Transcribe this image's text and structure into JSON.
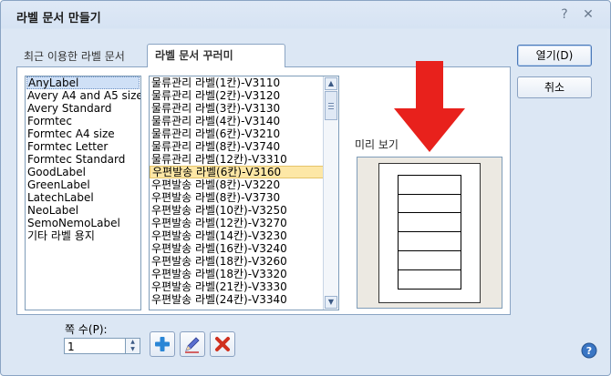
{
  "window": {
    "title": "라벨 문서 만들기",
    "help_glyph": "?",
    "close_glyph": "✕"
  },
  "tabs": [
    {
      "label": "최근 이용한 라벨 문서",
      "active": false
    },
    {
      "label": "라벨 문서 꾸러미",
      "active": true
    }
  ],
  "brands": [
    {
      "label": "AnyLabel",
      "selected": true
    },
    {
      "label": "Avery A4 and A5 size",
      "selected": false
    },
    {
      "label": "Avery Standard",
      "selected": false
    },
    {
      "label": "Formtec",
      "selected": false
    },
    {
      "label": "Formtec A4 size",
      "selected": false
    },
    {
      "label": "Formtec Letter",
      "selected": false
    },
    {
      "label": "Formtec Standard",
      "selected": false
    },
    {
      "label": "GoodLabel",
      "selected": false
    },
    {
      "label": "GreenLabel",
      "selected": false
    },
    {
      "label": "LatechLabel",
      "selected": false
    },
    {
      "label": "NeoLabel",
      "selected": false
    },
    {
      "label": "SemoNemoLabel",
      "selected": false
    },
    {
      "label": "기타 라벨 용지",
      "selected": false
    }
  ],
  "labels": [
    {
      "label": "물류관리 라벨(1칸)-V3110",
      "selected": false
    },
    {
      "label": "물류관리 라벨(2칸)-V3120",
      "selected": false
    },
    {
      "label": "물류관리 라벨(3칸)-V3130",
      "selected": false
    },
    {
      "label": "물류관리 라벨(4칸)-V3140",
      "selected": false
    },
    {
      "label": "물류관리 라벨(6칸)-V3210",
      "selected": false
    },
    {
      "label": "물류관리 라벨(8칸)-V3740",
      "selected": false
    },
    {
      "label": "물류관리 라벨(12칸)-V3310",
      "selected": false
    },
    {
      "label": "우편발송 라벨(6칸)-V3160",
      "selected": true
    },
    {
      "label": "우편발송 라벨(8칸)-V3220",
      "selected": false
    },
    {
      "label": "우편발송 라벨(8칸)-V3730",
      "selected": false
    },
    {
      "label": "우편발송 라벨(10칸)-V3250",
      "selected": false
    },
    {
      "label": "우편발송 라벨(12칸)-V3270",
      "selected": false
    },
    {
      "label": "우편발송 라벨(14칸)-V3230",
      "selected": false
    },
    {
      "label": "우편발송 라벨(16칸)-V3240",
      "selected": false
    },
    {
      "label": "우편발송 라벨(18칸)-V3260",
      "selected": false
    },
    {
      "label": "우편발송 라벨(18칸)-V3320",
      "selected": false
    },
    {
      "label": "우편발송 라벨(21칸)-V3330",
      "selected": false
    },
    {
      "label": "우편발송 라벨(24칸)-V3340",
      "selected": false
    }
  ],
  "preview": {
    "label": "미리 보기",
    "cells": 6
  },
  "buttons": {
    "open": "열기(D)",
    "cancel": "취소"
  },
  "columns": {
    "label": "쪽 수(P):",
    "value": "1"
  },
  "colors": {
    "arrow": "#e8211c",
    "add_icon": "#2a86d6",
    "delete_icon": "#d0301e"
  }
}
